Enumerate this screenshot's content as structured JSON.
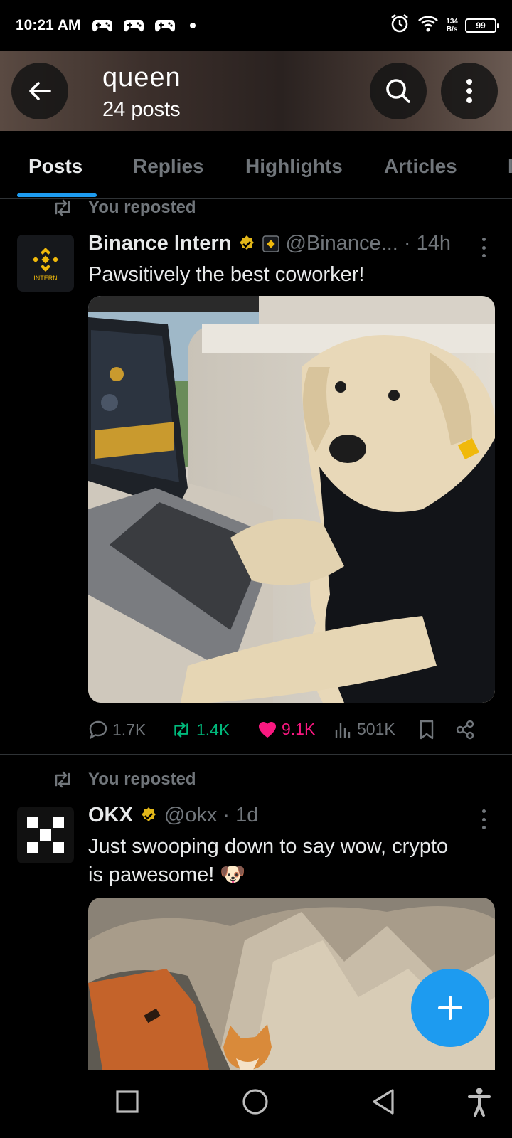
{
  "status_bar": {
    "time": "10:21 AM",
    "net_speed_value": "134",
    "net_speed_unit": "B/s",
    "battery": "99"
  },
  "header": {
    "title": "queen",
    "subtitle": "24 posts"
  },
  "tabs": [
    "Posts",
    "Replies",
    "Highlights",
    "Articles"
  ],
  "posts": [
    {
      "repost_label": "You reposted",
      "name": "Binance Intern",
      "handle": "@Binance...",
      "time": "· 14h",
      "avatar_text": "INTERN",
      "text": "Pawsitively the best coworker!",
      "stats": {
        "replies": "1.7K",
        "reposts": "1.4K",
        "likes": "9.1K",
        "views": "501K"
      }
    },
    {
      "repost_label": "You reposted",
      "name": "OKX",
      "handle": "@okx",
      "time": "· 1d",
      "text_line1": "Just swooping down to say wow, crypto",
      "text_line2": "is pawesome! 🐶"
    }
  ],
  "colors": {
    "accent": "#1d9bf0",
    "like": "#f91880",
    "repost": "#00ba7c",
    "verified": "#e2b719",
    "muted": "#71767b"
  },
  "icons": [
    "back-arrow-icon",
    "search-icon",
    "more-vertical-icon",
    "repost-icon",
    "verified-badge-icon",
    "reply-icon",
    "heart-icon",
    "views-icon",
    "bookmark-icon",
    "share-icon",
    "plus-icon"
  ]
}
